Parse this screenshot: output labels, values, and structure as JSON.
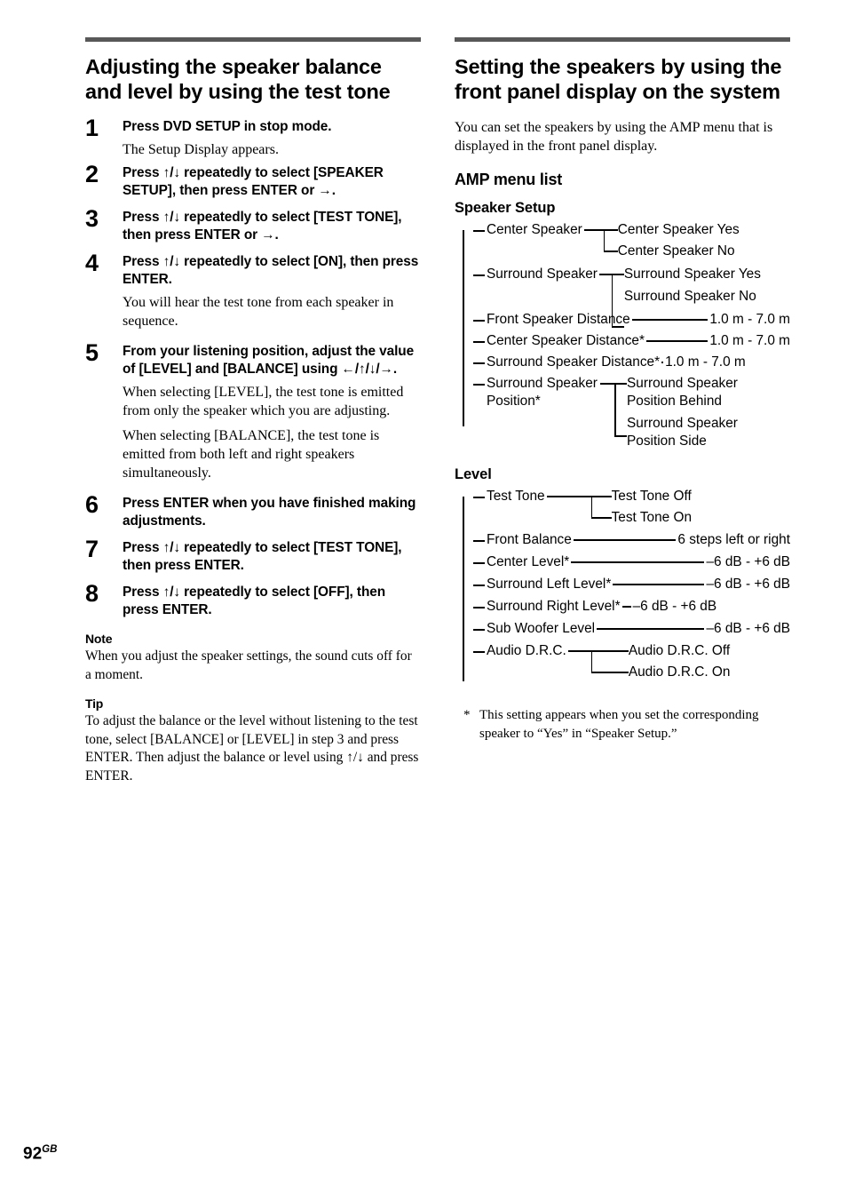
{
  "page": {
    "number": "92",
    "country_code": "GB"
  },
  "left_column": {
    "title": "Adjusting the speaker balance and level by using the test tone",
    "steps": [
      {
        "num": "1",
        "head": "Press DVD SETUP in stop mode.",
        "body": [
          "The Setup Display appears."
        ]
      },
      {
        "num": "2",
        "head": "Press ↑/↓ repeatedly to select [SPEAKER SETUP], then press ENTER or →.",
        "body": []
      },
      {
        "num": "3",
        "head": "Press ↑/↓ repeatedly to select [TEST TONE], then press ENTER or →.",
        "body": []
      },
      {
        "num": "4",
        "head": "Press ↑/↓ repeatedly to select [ON], then press ENTER.",
        "body": [
          "You will hear the test tone from each speaker in sequence."
        ]
      },
      {
        "num": "5",
        "head": "From your listening position, adjust the value of [LEVEL] and [BALANCE] using ←/↑/↓/→.",
        "body": [
          "When selecting [LEVEL], the test tone is emitted from only the speaker which you are adjusting.",
          "When selecting [BALANCE], the test tone is emitted from both left and right speakers simultaneously."
        ]
      },
      {
        "num": "6",
        "head": "Press ENTER when you have finished making adjustments.",
        "body": []
      },
      {
        "num": "7",
        "head": "Press ↑/↓ repeatedly to select [TEST TONE], then press ENTER.",
        "body": []
      },
      {
        "num": "8",
        "head": "Press ↑/↓ repeatedly to select [OFF], then press ENTER.",
        "body": []
      }
    ],
    "note": {
      "label": "Note",
      "text": "When you adjust the speaker settings, the sound cuts off for a moment."
    },
    "tip": {
      "label": "Tip",
      "text": "To adjust the balance or the level without listening to the test tone, select [BALANCE] or [LEVEL] in step 3 and press ENTER. Then adjust the balance or level using ↑/↓ and press ENTER."
    }
  },
  "right_column": {
    "title": "Setting the speakers by using the front panel display on the system",
    "intro": "You can set the speakers by using the AMP menu that is displayed in the front panel display.",
    "amp_menu_heading": "AMP menu list",
    "speaker_setup": {
      "heading": "Speaker Setup",
      "items": [
        {
          "label": "Center Speaker",
          "type": "branch",
          "children": [
            "Center Speaker Yes",
            "Center Speaker No"
          ]
        },
        {
          "label": "Surround Speaker",
          "type": "branch",
          "children": [
            "Surround Speaker Yes",
            "Surround Speaker No"
          ]
        },
        {
          "label": "Front Speaker Distance",
          "type": "value",
          "value": "1.0 m - 7.0 m"
        },
        {
          "label": "Center Speaker Distance*",
          "type": "value",
          "value": "1.0 m - 7.0 m"
        },
        {
          "label": "Surround Speaker Distance*",
          "type": "value",
          "value": "1.0 m - 7.0 m"
        },
        {
          "label": "Surround Speaker Position*",
          "type": "branch",
          "children": [
            "Surround Speaker Position Behind",
            "Surround Speaker Position Side"
          ]
        }
      ]
    },
    "level": {
      "heading": "Level",
      "items": [
        {
          "label": "Test Tone",
          "type": "branch",
          "children": [
            "Test Tone Off",
            "Test Tone On"
          ]
        },
        {
          "label": "Front Balance",
          "type": "value",
          "value": "6 steps left or right"
        },
        {
          "label": "Center Level*",
          "type": "value",
          "value": "–6 dB - +6 dB"
        },
        {
          "label": "Surround Left Level*",
          "type": "value",
          "value": "–6 dB - +6 dB"
        },
        {
          "label": "Surround Right Level*",
          "type": "value",
          "value": "–6 dB - +6 dB"
        },
        {
          "label": "Sub Woofer Level",
          "type": "value",
          "value": "–6 dB - +6 dB"
        },
        {
          "label": "Audio D.R.C.",
          "type": "branch",
          "children": [
            "Audio D.R.C. Off",
            "Audio D.R.C. On"
          ]
        }
      ]
    },
    "footnote": {
      "mark": "*",
      "text": "This setting appears when you set the corresponding speaker to “Yes” in “Speaker Setup.”"
    }
  }
}
